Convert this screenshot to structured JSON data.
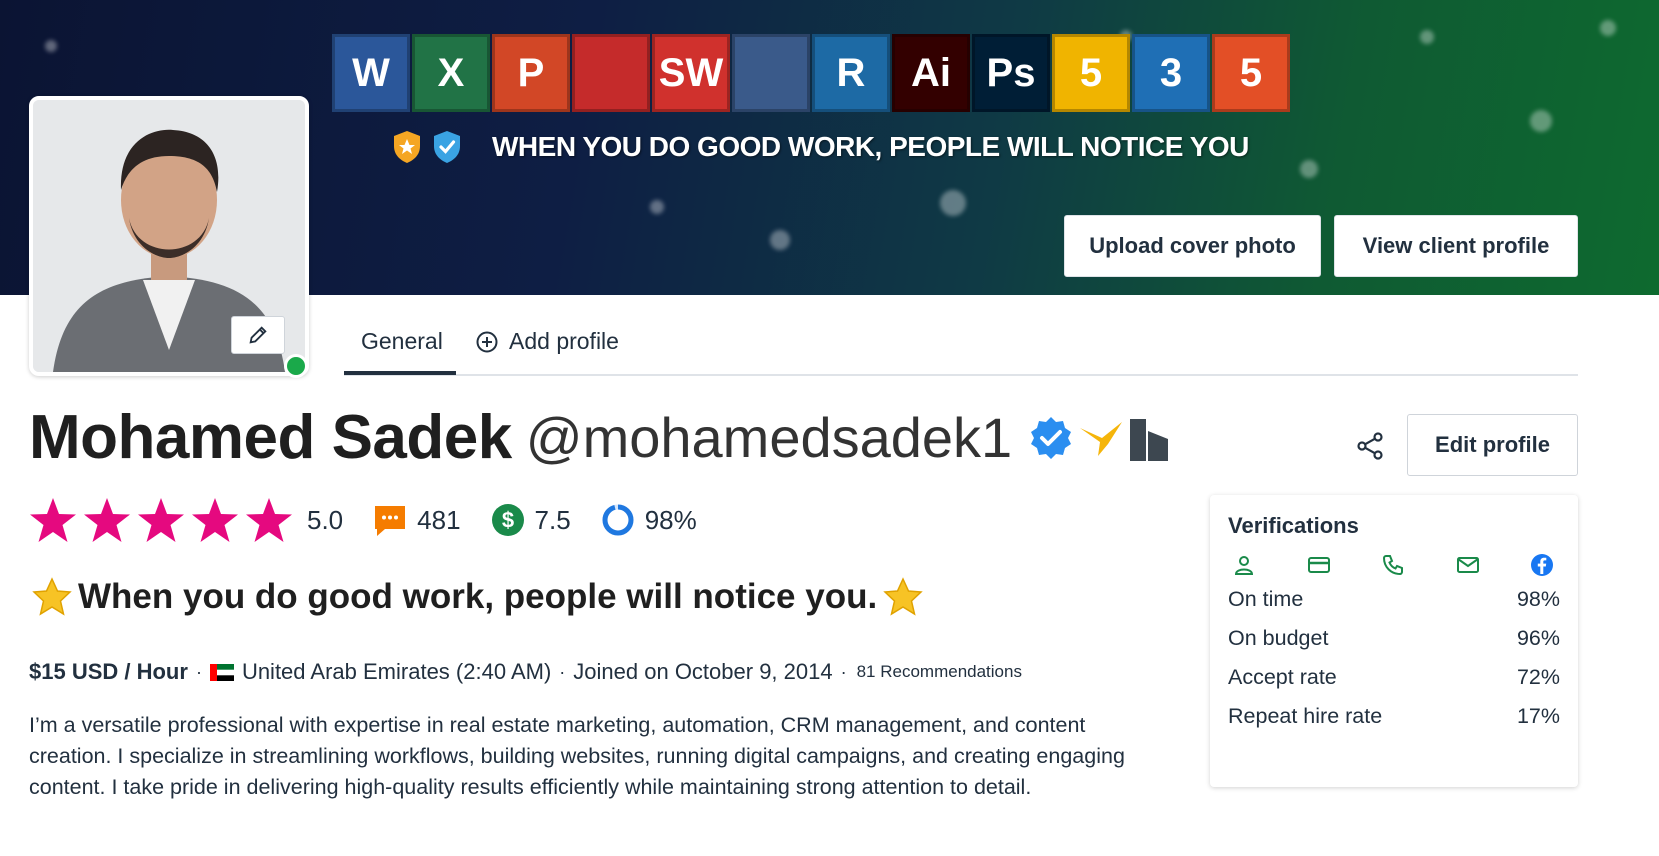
{
  "cover": {
    "tagline": "WHEN YOU DO GOOD WORK, PEOPLE WILL NOTICE YOU",
    "app_tiles": [
      {
        "label": "W",
        "icon": "word-icon",
        "color": "#2b579a"
      },
      {
        "label": "X",
        "icon": "excel-icon",
        "color": "#217346"
      },
      {
        "label": "P",
        "icon": "powerpoint-icon",
        "color": "#d24726"
      },
      {
        "label": "",
        "icon": "autocad-icon",
        "color": "#c52b2b"
      },
      {
        "label": "SW",
        "icon": "solidworks-icon",
        "color": "#d0312d"
      },
      {
        "label": "",
        "icon": "matlab-icon",
        "color": "#3a5a8a"
      },
      {
        "label": "R",
        "icon": "revit-icon",
        "color": "#1d6aa5"
      },
      {
        "label": "Ai",
        "icon": "illustrator-icon",
        "color": "#330000"
      },
      {
        "label": "Ps",
        "icon": "photoshop-icon",
        "color": "#001e36"
      },
      {
        "label": "5",
        "icon": "js-icon",
        "color": "#f0b400"
      },
      {
        "label": "3",
        "icon": "css3-icon",
        "color": "#1f6fb5"
      },
      {
        "label": "5",
        "icon": "html5-icon",
        "color": "#e34f26"
      }
    ],
    "upload_label": "Upload cover photo",
    "view_client_label": "View client profile"
  },
  "tabs": {
    "general": "General",
    "add_profile": "Add profile"
  },
  "profile": {
    "name": "Mohamed Sadek",
    "handle": "@mohamedsadek1",
    "edit_label": "Edit profile",
    "rating": "5.0",
    "reviews": "481",
    "earnings_score": "7.5",
    "completion": "98%",
    "headline": "When you do good work, people will notice you.",
    "rate": "$15 USD / Hour",
    "location": "United Arab Emirates (2:40 AM)",
    "joined": "Joined on October 9, 2014",
    "recommendations": "81 Recommendations",
    "bio": "I’m a versatile professional with expertise in real estate marketing, automation, CRM management, and content creation. I specialize in streamlining workflows, building websites, running digital campaigns, and creating engaging content. I take pride in delivering high-quality results efficiently while maintaining strong attention to detail."
  },
  "colors": {
    "star": "#e5097f",
    "verified_green": "#1a8a4a",
    "online": "#1aa94a",
    "facebook": "#1877f2"
  },
  "verifications": {
    "title": "Verifications",
    "icons": [
      "user-icon",
      "payment-card-icon",
      "phone-icon",
      "email-icon",
      "facebook-icon"
    ],
    "rows": [
      {
        "label": "On time",
        "value": "98%"
      },
      {
        "label": "On budget",
        "value": "96%"
      },
      {
        "label": "Accept rate",
        "value": "72%"
      },
      {
        "label": "Repeat hire rate",
        "value": "17%"
      }
    ]
  }
}
